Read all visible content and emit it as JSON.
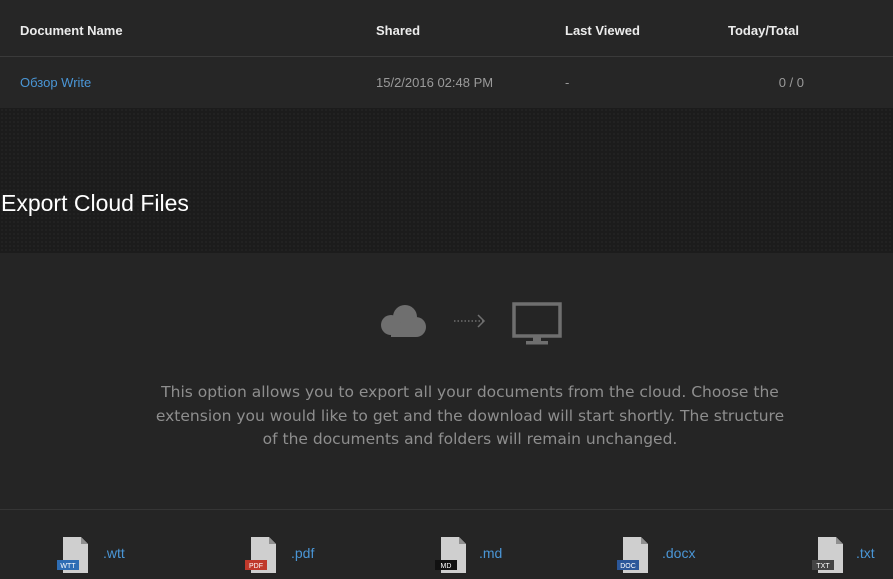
{
  "table": {
    "headers": {
      "name": "Document Name",
      "shared": "Shared",
      "last_viewed": "Last Viewed",
      "today_total": "Today/Total"
    },
    "rows": [
      {
        "name": "Обзор Write",
        "shared": "15/2/2016 02:48 PM",
        "last_viewed": "-",
        "today_total": "0 / 0"
      }
    ]
  },
  "export": {
    "title": "Export Cloud Files",
    "description": "This option allows you to export all your documents from the cloud. Choose the extension you would like to get and the download will start shortly. The structure of the documents and folders will remain unchanged.",
    "formats": [
      {
        "ext": ".wtt",
        "badge": "WTT",
        "badge_color": "#2e6db4"
      },
      {
        "ext": ".pdf",
        "badge": "PDF",
        "badge_color": "#c0392b"
      },
      {
        "ext": ".md",
        "badge": "MD",
        "badge_color": "#111111"
      },
      {
        "ext": ".docx",
        "badge": "DOC",
        "badge_color": "#2b579a"
      },
      {
        "ext": ".txt",
        "badge": "TXT",
        "badge_color": "#444444"
      }
    ]
  },
  "colors": {
    "link": "#4a96d6",
    "icon_gray": "#6f6f6f"
  }
}
